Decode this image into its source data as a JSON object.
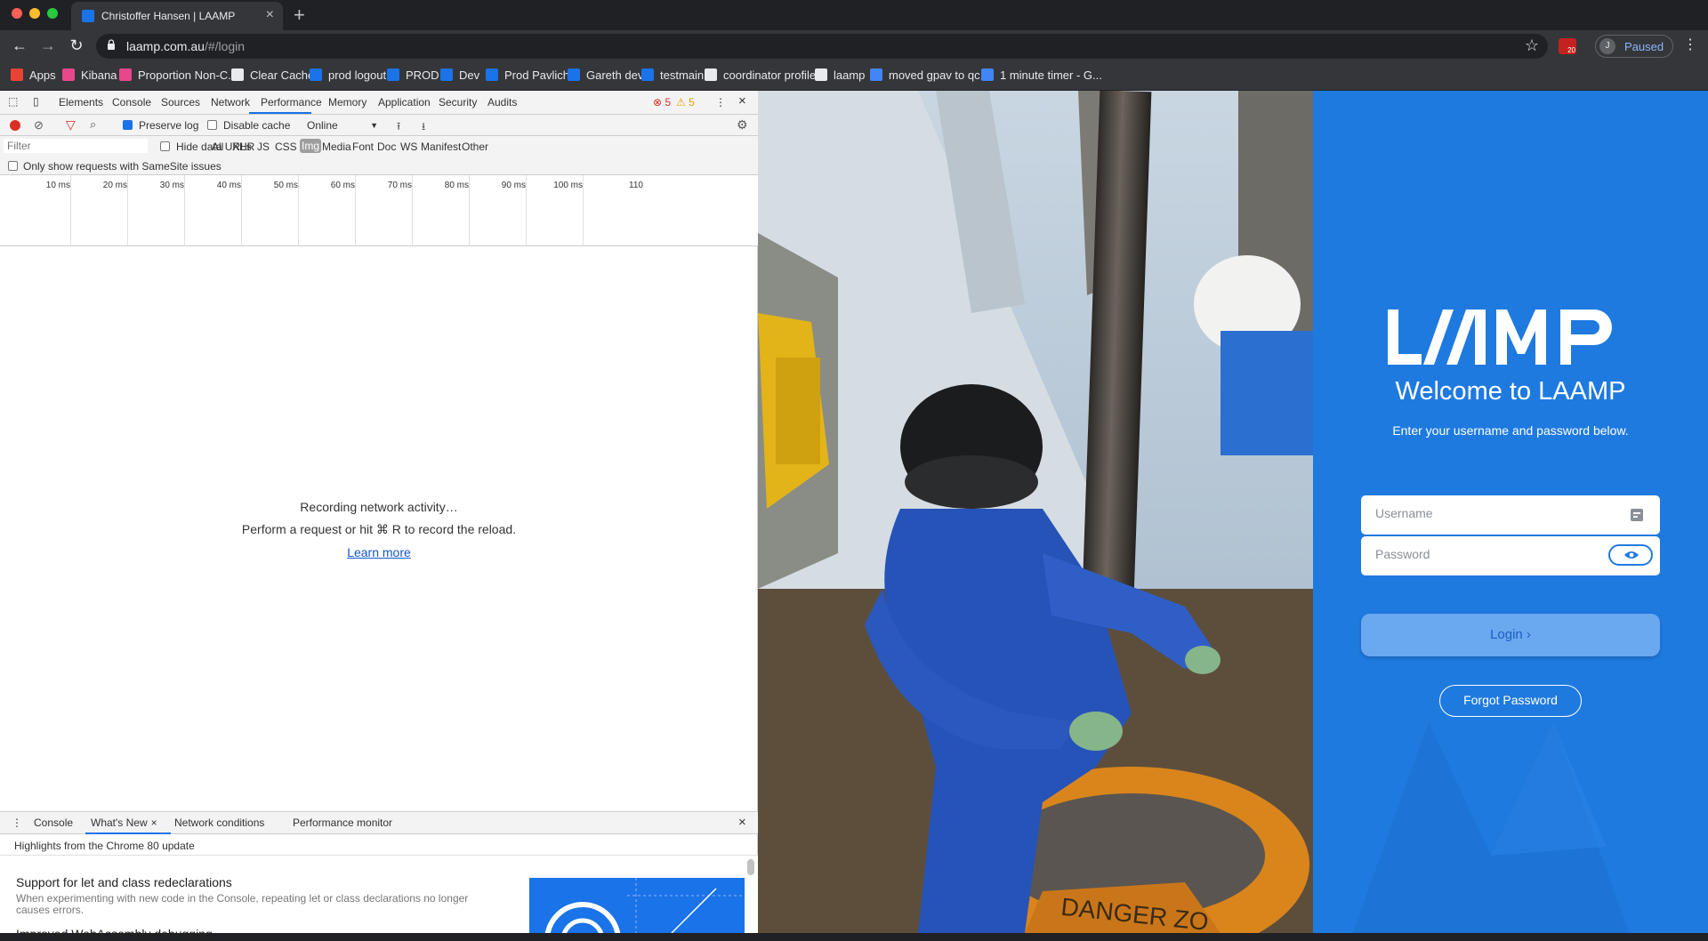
{
  "browser": {
    "tab_title": "Christoffer Hansen | LAAMP",
    "url_host": "laamp.com.au",
    "url_path": "/#/login",
    "profile_initial": "J",
    "profile_status": "Paused",
    "extension_badge": "20"
  },
  "bookmarks": [
    {
      "label": "Apps",
      "color": "#ea4335"
    },
    {
      "label": "Kibana",
      "color": "#e8488b"
    },
    {
      "label": "Proportion Non-C...",
      "color": "#e8488b"
    },
    {
      "label": "Clear Cache",
      "color": "#e8eaed"
    },
    {
      "label": "prod logout",
      "color": "#1a73e8"
    },
    {
      "label": "PROD",
      "color": "#1a73e8"
    },
    {
      "label": "Dev",
      "color": "#1a73e8"
    },
    {
      "label": "Prod Pavlich",
      "color": "#1a73e8"
    },
    {
      "label": "Gareth dev",
      "color": "#1a73e8"
    },
    {
      "label": "testmain",
      "color": "#1a73e8"
    },
    {
      "label": "coordinator profiles",
      "color": "#e8eaed"
    },
    {
      "label": "laamp",
      "color": "#e8eaed"
    },
    {
      "label": "moved gpav to qc...",
      "color": "#4285f4"
    },
    {
      "label": "1 minute timer - G...",
      "color": "#4285f4"
    }
  ],
  "devtools": {
    "tabs": [
      "Elements",
      "Console",
      "Sources",
      "Network",
      "Performance",
      "Memory",
      "Application",
      "Security",
      "Audits"
    ],
    "active_tab": "Network",
    "errors": "5",
    "warnings": "5",
    "preserve_log": "Preserve log",
    "disable_cache": "Disable cache",
    "throttle": "Online",
    "filter_placeholder": "Filter",
    "hide_data_urls": "Hide data URLs",
    "type_filters": [
      "All",
      "XHR",
      "JS",
      "CSS",
      "Img",
      "Media",
      "Font",
      "Doc",
      "WS",
      "Manifest",
      "Other"
    ],
    "active_type_filter": "Img",
    "samesite": "Only show requests with SameSite issues",
    "timeline_ticks": [
      "10 ms",
      "20 ms",
      "30 ms",
      "40 ms",
      "50 ms",
      "60 ms",
      "70 ms",
      "80 ms",
      "90 ms",
      "100 ms",
      "110"
    ],
    "empty_line1": "Recording network activity…",
    "empty_line2": "Perform a request or hit ⌘ R to record the reload.",
    "learn_more": "Learn more",
    "drawer_tabs": [
      "Console",
      "What's New",
      "Network conditions",
      "Performance monitor"
    ],
    "drawer_highlights": "Highlights from the Chrome 80 update",
    "drawer_item_title": "Support for let and class redeclarations",
    "drawer_item_desc": "When experimenting with new code in the Console, repeating let or class declarations no longer causes errors.",
    "drawer_item_next": "Improved WebAssembly debugging"
  },
  "photo": {
    "sign_text": "DANGER ZO"
  },
  "login": {
    "logo_text": "LAAMP",
    "welcome": "Welcome to LAAMP",
    "subtitle": "Enter your username and password below.",
    "username_placeholder": "Username",
    "password_placeholder": "Password",
    "login_label": "Login ›",
    "forgot_label": "Forgot Password",
    "bg_color": "#1f7ae0"
  }
}
